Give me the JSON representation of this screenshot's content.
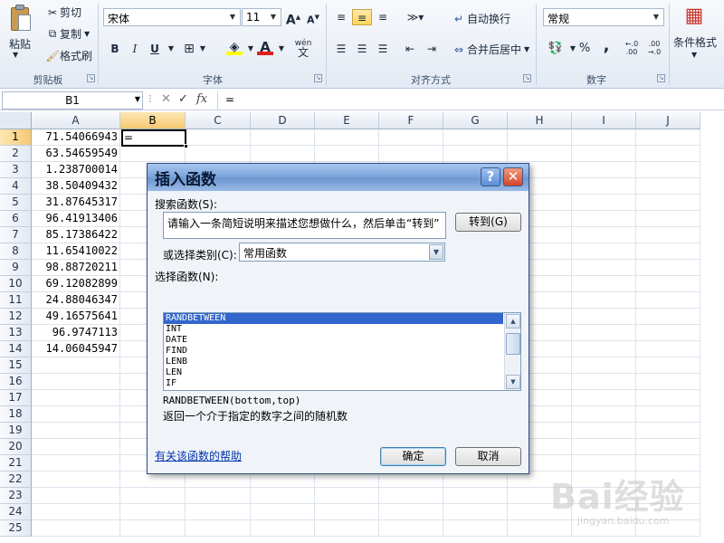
{
  "ribbon": {
    "clipboard": {
      "paste": "粘贴",
      "cut": "剪切",
      "copy": "复制",
      "format_painter": "格式刷",
      "group": "剪贴板"
    },
    "font": {
      "name": "宋体",
      "size": "11",
      "group": "字体",
      "bold": "B",
      "italic": "I",
      "underline": "U",
      "grow": "A",
      "shrink": "A",
      "font_color": "A",
      "wen": "wén"
    },
    "alignment": {
      "wrap": "自动换行",
      "merge": "合并后居中",
      "group": "对齐方式"
    },
    "number": {
      "format": "常规",
      "percent": "%",
      "comma": ",",
      "group": "数字"
    },
    "styles": {
      "conditional": "条件格式"
    }
  },
  "formula_bar": {
    "name_box": "B1",
    "fx": "fx",
    "content": "="
  },
  "grid": {
    "columns": [
      "A",
      "B",
      "C",
      "D",
      "E",
      "F",
      "G",
      "H",
      "I",
      "J"
    ],
    "rows": [
      "1",
      "2",
      "3",
      "4",
      "5",
      "6",
      "7",
      "8",
      "9",
      "10",
      "11",
      "12",
      "13",
      "14",
      "15",
      "16",
      "17",
      "18",
      "19",
      "20",
      "21",
      "22",
      "23",
      "24",
      "25"
    ],
    "col_a": [
      "71.54066943",
      "63.54659549",
      "1.238700014",
      "38.50409432",
      "31.87645317",
      "96.41913406",
      "85.17386422",
      "11.65410022",
      "98.88720211",
      "69.12082899",
      "24.88046347",
      "49.16575641",
      "96.9747113",
      "14.06045947"
    ],
    "b1": "="
  },
  "dialog": {
    "title": "插入函数",
    "help_btn": "?",
    "close_btn": "✕",
    "search_label": "搜索函数(S):",
    "search_value": "请输入一条简短说明来描述您想做什么，然后单击“转到”",
    "go_btn": "转到(G)",
    "category_label": "或选择类别(C):",
    "category_value": "常用函数",
    "select_label": "选择函数(N):",
    "functions": [
      "RANDBETWEEN",
      "INT",
      "DATE",
      "FIND",
      "LENB",
      "LEN",
      "IF"
    ],
    "signature": "RANDBETWEEN(bottom,top)",
    "description": "返回一个介于指定的数字之间的随机数",
    "help_link": "有关该函数的帮助",
    "ok": "确定",
    "cancel": "取消"
  },
  "watermark": {
    "brand": "Bai经验",
    "url": "jingyan.baidu.com"
  }
}
